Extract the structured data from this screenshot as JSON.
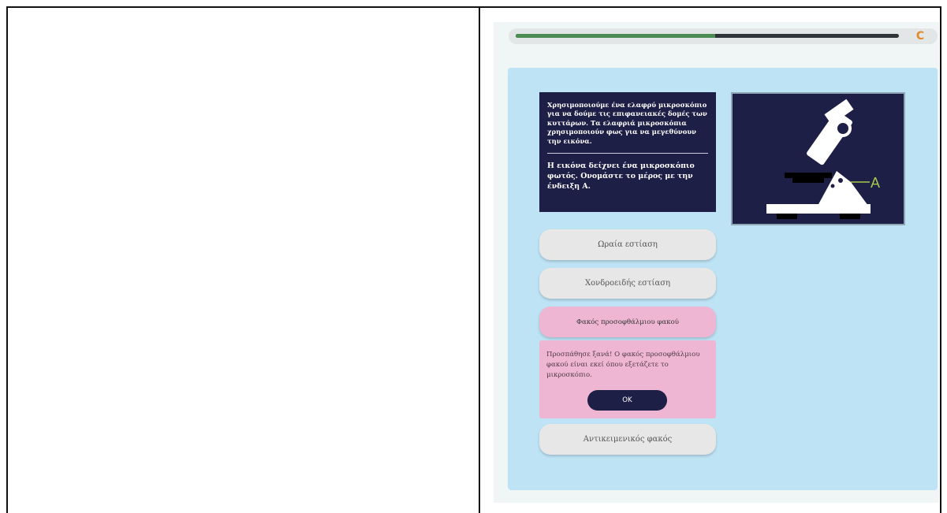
{
  "progress": {
    "value": 0.52,
    "fill_color": "#4a8c51",
    "track_color": "#2f3438",
    "reload_icon": "reload-icon",
    "reload_glyph": "C"
  },
  "question": {
    "intro": "Χρησιμοποιούμε ένα ελαφρύ μικροσκόπιο για να δούμε τις επιφανειακές δομές των κυττάρων. Τα ελαφριά μικροσκόπια χρησιμοποιούν φως για να μεγεθύνουν την εικόνα.",
    "ask": "Η εικόνα δείχνει ένα μικροσκόπιο φωτός. Ονομάστε το μέρος με την ένδειξη Α."
  },
  "figure": {
    "label": "A",
    "label_color": "#a3c84a",
    "background": "#1e1f47"
  },
  "options": [
    {
      "label": "Ωραία εστίαση",
      "state": "default"
    },
    {
      "label": "Χονδροειδής εστίαση",
      "state": "default"
    },
    {
      "label": "Φακός προσοφθάλμιου φακού",
      "state": "incorrect"
    },
    {
      "label": "Αντικειμενικός φακός",
      "state": "default"
    }
  ],
  "feedback": {
    "message": "Προσπάθησε ξανά! Ο φακός προσοφθάλμιου φακού είναι εκεί όπου εξετάζετε το μικροσκόπιο.",
    "ok_label": "OK"
  },
  "colors": {
    "card_bg": "#bde3f5",
    "navy": "#1e1f47",
    "incorrect_pink": "#efb6d4",
    "option_grey": "#e7e7e8"
  }
}
